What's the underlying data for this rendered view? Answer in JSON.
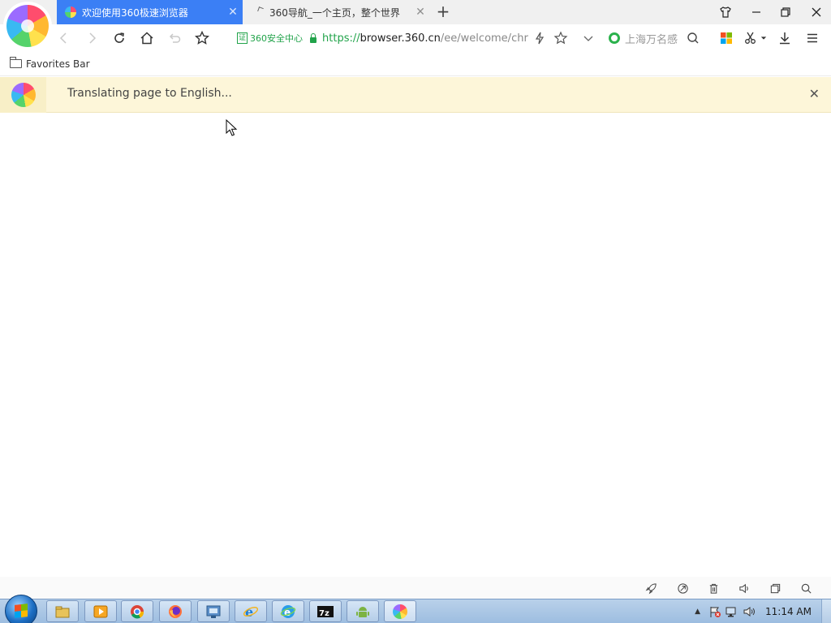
{
  "tabs": [
    {
      "label": "欢迎使用360极速浏览器",
      "active": true
    },
    {
      "label": "360导航_一个主页，整个世界",
      "active": false
    }
  ],
  "address": {
    "cert_label": "360安全中心",
    "url_scheme": "https://",
    "url_host": "browser.360.cn",
    "url_path": "/ee/welcome/chr"
  },
  "search": {
    "text": "上海万名感"
  },
  "favorites_bar": {
    "label": "Favorites Bar"
  },
  "translate_bar": {
    "message": "Translating page to English..."
  },
  "taskbar": {
    "clock": "11:14 AM"
  },
  "colors": {
    "active_tab": "#3b7ff5",
    "secure_green": "#21a34a",
    "infobar_bg": "#fdf6d9"
  }
}
